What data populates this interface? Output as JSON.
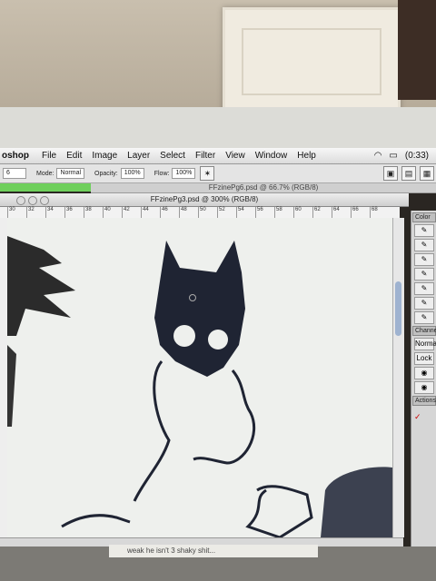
{
  "menubar": {
    "app": "oshop",
    "items": [
      "File",
      "Edit",
      "Image",
      "Layer",
      "Select",
      "Filter",
      "View",
      "Window",
      "Help"
    ],
    "battery": "(0:33)"
  },
  "options": {
    "brush_size": "6",
    "mode_label": "Mode:",
    "mode_value": "Normal",
    "opacity_label": "Opacity:",
    "opacity_value": "100%",
    "flow_label": "Flow:",
    "flow_value": "100%"
  },
  "back_doc_title": "FFzinePg6.psd @ 66.7% (RGB/8)",
  "doc_title": "FFzinePg3.psd @ 300% (RGB/8)",
  "ruler_ticks": [
    "30",
    "32",
    "34",
    "36",
    "38",
    "40",
    "42",
    "44",
    "46",
    "48",
    "50",
    "52",
    "54",
    "56",
    "58",
    "60",
    "62",
    "64",
    "66",
    "68"
  ],
  "right_panel": {
    "tab1": "Color",
    "tab2": "Channel",
    "normal": "Normal",
    "lock": "Lock",
    "actions": "Actions"
  },
  "paper_note": "weak he isn't 3 shaky shit..."
}
